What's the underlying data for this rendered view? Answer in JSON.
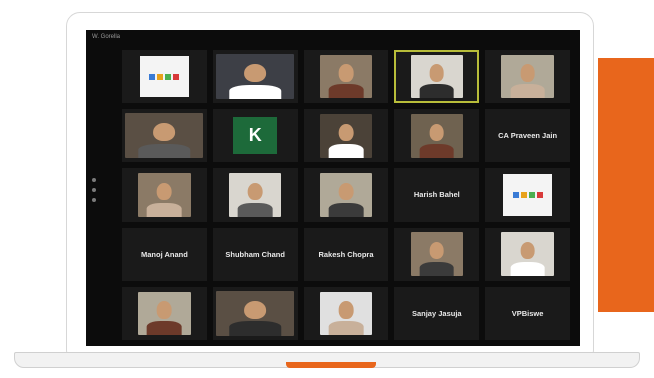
{
  "meeting": {
    "title": "W. Gorella"
  },
  "colors": {
    "accent": "#e8661c",
    "active_border": "#b8bd3a",
    "screen_bg": "#0c0c0c",
    "tile_bg": "#1a1a1a"
  },
  "tiles": [
    {
      "kind": "logo",
      "name": ""
    },
    {
      "kind": "video",
      "name": ""
    },
    {
      "kind": "video",
      "name": ""
    },
    {
      "kind": "video",
      "name": "",
      "active": true
    },
    {
      "kind": "video",
      "name": ""
    },
    {
      "kind": "video",
      "name": ""
    },
    {
      "kind": "avatar",
      "initial": "K",
      "name": ""
    },
    {
      "kind": "video",
      "name": ""
    },
    {
      "kind": "video",
      "name": ""
    },
    {
      "kind": "name",
      "name": "CA Praveen Jain"
    },
    {
      "kind": "video",
      "name": ""
    },
    {
      "kind": "video",
      "name": ""
    },
    {
      "kind": "video",
      "name": ""
    },
    {
      "kind": "name",
      "name": "Harish Bahel"
    },
    {
      "kind": "logo",
      "name": ""
    },
    {
      "kind": "name",
      "name": "Manoj Anand"
    },
    {
      "kind": "name",
      "name": "Shubham Chand"
    },
    {
      "kind": "name",
      "name": "Rakesh Chopra"
    },
    {
      "kind": "video",
      "name": ""
    },
    {
      "kind": "video",
      "name": ""
    },
    {
      "kind": "video",
      "name": ""
    },
    {
      "kind": "video",
      "name": ""
    },
    {
      "kind": "video",
      "name": ""
    },
    {
      "kind": "name",
      "name": "Sanjay Jasuja"
    },
    {
      "kind": "name",
      "name": "VPBiswe"
    }
  ]
}
